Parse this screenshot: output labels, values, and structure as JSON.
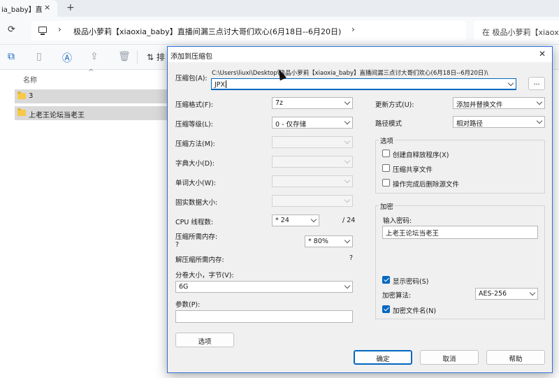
{
  "explorer": {
    "tab_title": "ia_baby】直",
    "tab_close": "×",
    "tab_new": "+",
    "refresh_icon": "⟳",
    "breadcrumb_sep": "›",
    "path": "极品小萝莉【xiaoxia_baby】直播间漏三点讨大哥们欢心(6月18日--6月20日)",
    "search_placeholder": "在 极品小萝莉【xiaox",
    "sort_label": "排",
    "column_name": "名称",
    "sort_caret": "^",
    "files": [
      {
        "name": "3"
      },
      {
        "name": "上老王论坛当老王"
      }
    ]
  },
  "dialog": {
    "title": "添加到压缩包",
    "close": "✕",
    "archive_label": "压缩包(A):",
    "archive_path": "C:\\Users\\liuxi\\Desktop\\极品小萝莉【xiaoxia_baby】直播间漏三点讨大哥们欢心(6月18日--6月20日)\\",
    "archive_name": "JPX",
    "browse": "...",
    "format_label": "压缩格式(F):",
    "format_value": "7z",
    "level_label": "压缩等级(L):",
    "level_value": "0 - 仅存储",
    "method_label": "压缩方法(M):",
    "dict_label": "字典大小(D):",
    "word_label": "单词大小(W):",
    "solid_label": "固实数据大小:",
    "cpu_label": "CPU 线程数:",
    "cpu_value": "* 24",
    "cpu_total": "/ 24",
    "mem_comp_label": "压缩所需内存:",
    "mem_comp_q": "?",
    "mem_comp_value": "* 80%",
    "mem_decomp_label": "解压缩所需内存:",
    "mem_decomp_q": "?",
    "split_label": "分卷大小，字节(V):",
    "split_value": "6G",
    "params_label": "参数(P):",
    "options_button": "选项",
    "update_label": "更新方式(U):",
    "update_value": "添加并替换文件",
    "path_mode_label": "路径模式",
    "path_mode_value": "相对路径",
    "options_group": "选项",
    "opt_sfx": "创建自释放程序(X)",
    "opt_shared": "压缩共享文件",
    "opt_delete": "操作完成后删除源文件",
    "encrypt_group": "加密",
    "password_label": "输入密码:",
    "password_value": "上老王论坛当老王",
    "show_password": "显示密码(S)",
    "enc_method_label": "加密算法:",
    "enc_method_value": "AES-256",
    "encrypt_names": "加密文件名(N)",
    "ok": "确定",
    "cancel": "取消",
    "help": "帮助"
  }
}
